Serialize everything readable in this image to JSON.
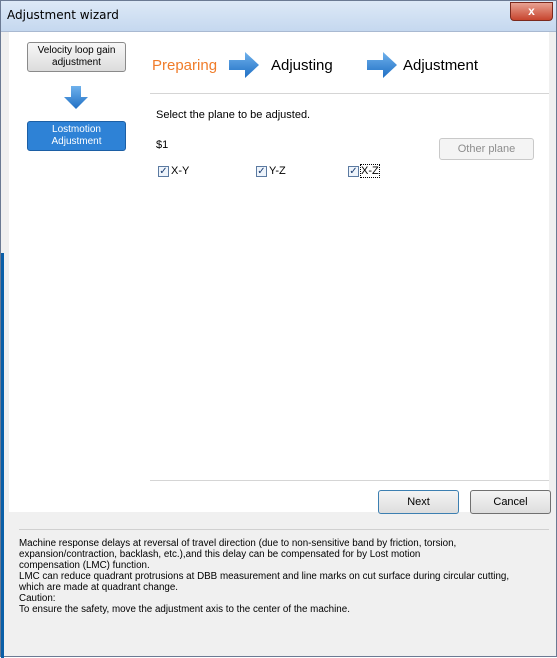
{
  "window": {
    "title": "Adjustment wizard",
    "close_glyph": "x"
  },
  "steps": [
    {
      "label": "Velocity loop gain adjustment",
      "active": false
    },
    {
      "label": "Lostmotion Adjustment",
      "active": true
    }
  ],
  "phases": {
    "preparing": "Preparing",
    "adjusting": "Adjusting",
    "adjustment": "Adjustment",
    "current_color": "#f07c2a",
    "arrow_color": "#2e86d6"
  },
  "content": {
    "instruction": "Select the plane to be adjusted.",
    "axis_name": "$1",
    "other_plane_label": "Other plane",
    "planes": [
      {
        "label": "X-Y",
        "checked": true
      },
      {
        "label": "Y-Z",
        "checked": true
      },
      {
        "label": "X-Z",
        "checked": true
      }
    ]
  },
  "buttons": {
    "next": "Next",
    "cancel": "Cancel"
  },
  "description": {
    "lines": [
      "Machine response delays at reversal of travel direction (due to non-sensitive band by friction, torsion,",
      "expansion/contraction, backlash, etc.),and this delay can be compensated for by Lost motion",
      "compensation (LMC) function.",
      "LMC can reduce quadrant protrusions at DBB measurement and line marks on cut surface during circular cutting,",
      "which are made at quadrant change.",
      "Caution:",
      "To ensure the safety, move the adjustment axis to the center of the machine."
    ]
  }
}
